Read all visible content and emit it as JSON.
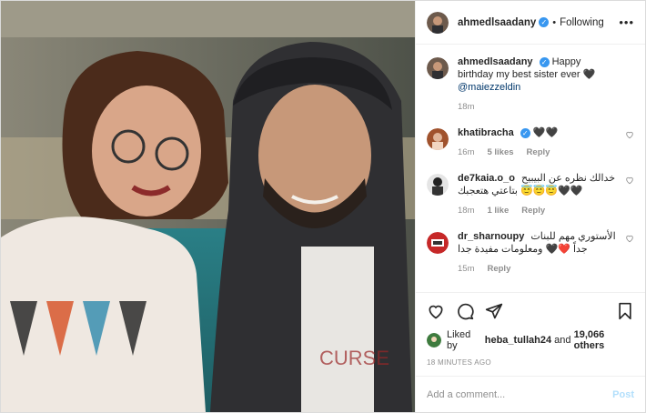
{
  "header": {
    "username": "ahmedlsaadany",
    "follow_label": "Following",
    "separator": "•",
    "more_label": "•••"
  },
  "caption": {
    "username": "ahmedlsaadany",
    "text": "Happy birthday my best sister ever 🖤",
    "mention": "@maiezzeldin",
    "time": "18m"
  },
  "comments": [
    {
      "username": "khatibracha",
      "text": "🖤🖤",
      "time": "16m",
      "likes": "5 likes",
      "reply": "Reply"
    },
    {
      "username": "de7kaia.o_o",
      "text": "خدالك نظره عن البيبيح 🖤🖤😇😇😇 بتاعتي هتعجبك",
      "time": "18m",
      "likes": "1 like",
      "reply": "Reply"
    },
    {
      "username": "dr_sharnoupy",
      "text": "الأستوري مهم للبنات جداً ❤️🖤 ومعلومات مفيدة جدا",
      "time": "15m",
      "likes": "",
      "reply": "Reply"
    }
  ],
  "likes": {
    "prefix": "Liked by",
    "user": "heba_tullah24",
    "joiner": "and",
    "others": "19,066 others"
  },
  "timestamp": "18 MINUTES AGO",
  "add_comment": {
    "placeholder": "Add a comment...",
    "post_label": "Post"
  },
  "icons": [
    "heart-icon",
    "comment-icon",
    "share-icon",
    "bookmark-icon",
    "heart-small-icon",
    "verified-icon",
    "more-icon"
  ],
  "colors": {
    "verified": "#3897f0",
    "link": "#00376b",
    "muted": "#8e8e8e",
    "post_disabled": "#b2dffc"
  }
}
